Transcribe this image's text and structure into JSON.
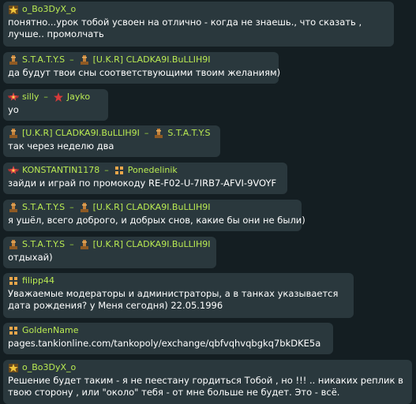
{
  "messages": [
    {
      "from": "o_Bo3DyX_o",
      "text": "понятно...урок тобой усвоен на отлично - когда не знаешь., что сказать , лучше.. промолчать"
    },
    {
      "from": "S.T.A.T.Y.S",
      "to": "[U.K.R] CLADKA9I.BuLLIH9I",
      "text": "да будут твои сны соответствующими твоим желаниям)"
    },
    {
      "from": "silly",
      "to": "Jayko",
      "text": "yo"
    },
    {
      "from": "[U.K.R] CLADKA9I.BuLLIH9I",
      "to": "S.T.A.T.Y.S",
      "text": "так через неделю два"
    },
    {
      "from": "KONSTANTIN1178",
      "to": "Ponedelinik",
      "text": "зайди и играй по промокоду RE-F02-U-7IRB7-AFVI-9VOYF"
    },
    {
      "from": "S.T.A.T.Y.S",
      "to": "[U.K.R] CLADKA9I.BuLLIH9I",
      "text": "я ушёл, всего доброго, и добрых снов, какие бы они не были)"
    },
    {
      "from": "S.T.A.T.Y.S",
      "to": "[U.K.R] CLADKA9I.BuLLIH9I",
      "text": "отдыхай)"
    },
    {
      "from": "filipp44",
      "text": "Уважаемые модераторы и администраторы, а в танках указывается дата рождения? у Меня сегодня) 22.05.1996"
    },
    {
      "from": "GoldenName",
      "text": "pages.tankionline.com/tankopoly/exchange/qbfvqhvqbgkq7bkDKE5a"
    },
    {
      "from": "o_Bo3DyX_o",
      "text": "Решение будет таким - я не пеестану гордиться Тобой , но !!! .. никаких реплик в твою сторону , или \"около\" тебя - от мне больше не будет. Это - всё."
    }
  ],
  "separator": "–",
  "rank_icons": {
    "o_Bo3DyX_o": "star-rank-icon",
    "S.T.A.T.Y.S": "warrant-rank-icon",
    "[U.K.R] CLADKA9I.BuLLIH9I": "warrant-rank-icon",
    "silly": "winged-star-rank-icon",
    "Jayko": "star-rank-icon",
    "KONSTANTIN1178": "winged-star-rank-icon",
    "Ponedelinik": "recruit-rank-icon",
    "filipp44": "recruit-rank-icon",
    "GoldenName": "recruit-rank-icon"
  },
  "colors": {
    "background": "#141e22",
    "bubble": "#2a383d",
    "nickname": "#b9ea52",
    "text": "#ffffff"
  }
}
